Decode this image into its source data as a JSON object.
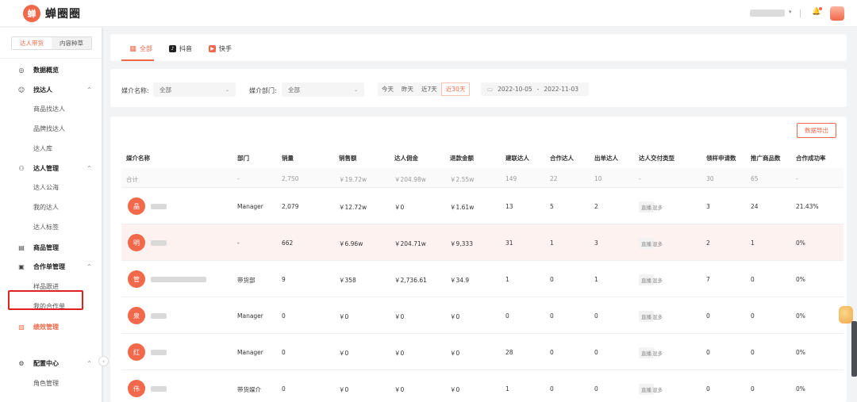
{
  "brand": {
    "logo_glyph": "蝉",
    "name": "蝉圈圈"
  },
  "sidebar": {
    "tabs": [
      "达人带货",
      "内容种草"
    ],
    "items": [
      {
        "label": "数据概览",
        "icon": "target-icon",
        "type": "group"
      },
      {
        "label": "找达人",
        "icon": "search-person-icon",
        "type": "group",
        "chevron": "^"
      },
      {
        "label": "商品找达人",
        "type": "sub"
      },
      {
        "label": "品牌找达人",
        "type": "sub"
      },
      {
        "label": "达人库",
        "type": "sub"
      },
      {
        "label": "达人管理",
        "icon": "person-manage-icon",
        "type": "group",
        "chevron": "^"
      },
      {
        "label": "达人公海",
        "type": "sub"
      },
      {
        "label": "我的达人",
        "type": "sub"
      },
      {
        "label": "达人标签",
        "type": "sub"
      },
      {
        "label": "商品管理",
        "icon": "box-icon",
        "type": "group"
      },
      {
        "label": "合作单管理",
        "icon": "clipboard-icon",
        "type": "group",
        "chevron": "^"
      },
      {
        "label": "样品跟进",
        "type": "sub"
      },
      {
        "label": "我的合作单",
        "type": "sub"
      },
      {
        "label": "绩效管理",
        "icon": "chart-icon",
        "type": "group",
        "active": true
      },
      {
        "label": "配置中心",
        "icon": "settings-icon",
        "type": "group",
        "chevron": "^"
      },
      {
        "label": "角色管理",
        "type": "sub"
      }
    ]
  },
  "platform_tabs": [
    {
      "label": "全部",
      "icon": "grid-icon",
      "active": true
    },
    {
      "label": "抖音",
      "icon": "douyin-icon"
    },
    {
      "label": "快手",
      "icon": "kuaishou-icon"
    }
  ],
  "filters": {
    "agency_label": "媒介名称:",
    "agency_value": "全部",
    "dept_label": "媒介部门:",
    "dept_value": "全部",
    "date_buttons": [
      "今天",
      "昨天",
      "近7天",
      "近30天"
    ],
    "active_date": "近30天",
    "date_start": "2022-10-05",
    "date_sep": "-",
    "date_end": "2022-11-03"
  },
  "table": {
    "export_label": "数据导出",
    "columns": [
      "媒介名称",
      "部门",
      "销量",
      "销售额",
      "达人佣金",
      "退款金额",
      "建联达人",
      "合作达人",
      "出单达人",
      "达人交付类型",
      "领样申请数",
      "推广商品数",
      "合作成功率"
    ],
    "total": [
      "合计",
      "-",
      "2,750",
      "￥19.72w",
      "￥204.98w",
      "￥2.55w",
      "149",
      "22",
      "10",
      "-",
      "30",
      "65",
      "-"
    ],
    "rows": [
      {
        "avatar": "晶",
        "dept": "Manager",
        "sales": "2,079",
        "revenue": "￥12.72w",
        "commission": "￥0",
        "refund": "￥1.61w",
        "contacted": "13",
        "cooperating": "5",
        "ordering": "2",
        "delivery_tags": [
          "直播",
          "混多"
        ],
        "sample_requests": "3",
        "products": "24",
        "success_rate": "21.43%"
      },
      {
        "avatar": "明",
        "dept": "-",
        "sales": "662",
        "revenue": "￥6.96w",
        "commission": "￥204.71w",
        "refund": "￥9,333",
        "contacted": "31",
        "cooperating": "1",
        "ordering": "3",
        "delivery_tags": [
          "直播",
          "混多"
        ],
        "sample_requests": "2",
        "products": "1",
        "success_rate": "0%"
      },
      {
        "avatar": "管",
        "dept": "带货部",
        "sales": "9",
        "revenue": "￥358",
        "commission": "￥2,736.61",
        "refund": "￥34.9",
        "contacted": "1",
        "cooperating": "0",
        "ordering": "1",
        "delivery_tags": [
          "直播",
          "混多"
        ],
        "sample_requests": "7",
        "products": "0",
        "success_rate": "0%"
      },
      {
        "avatar": "泉",
        "dept": "Manager",
        "sales": "0",
        "revenue": "￥0",
        "commission": "￥0",
        "refund": "￥0",
        "contacted": "0",
        "cooperating": "0",
        "ordering": "0",
        "delivery_tags": [
          "直播",
          "混多"
        ],
        "sample_requests": "0",
        "products": "0",
        "success_rate": "0%"
      },
      {
        "avatar": "红",
        "dept": "Manager",
        "sales": "0",
        "revenue": "￥0",
        "commission": "￥0",
        "refund": "￥0",
        "contacted": "28",
        "cooperating": "0",
        "ordering": "0",
        "delivery_tags": [
          "直播",
          "混多"
        ],
        "sample_requests": "0",
        "products": "0",
        "success_rate": "0%"
      },
      {
        "avatar": "伟",
        "dept": "带货媒介",
        "sales": "0",
        "revenue": "￥0",
        "commission": "￥0",
        "refund": "￥0",
        "contacted": "1",
        "cooperating": "0",
        "ordering": "0",
        "delivery_tags": [
          "直播",
          "混多"
        ],
        "sample_requests": "0",
        "products": "0",
        "success_rate": "0%"
      }
    ]
  },
  "colors": {
    "accent": "#f2684a",
    "highlight_border": "#e02020"
  }
}
